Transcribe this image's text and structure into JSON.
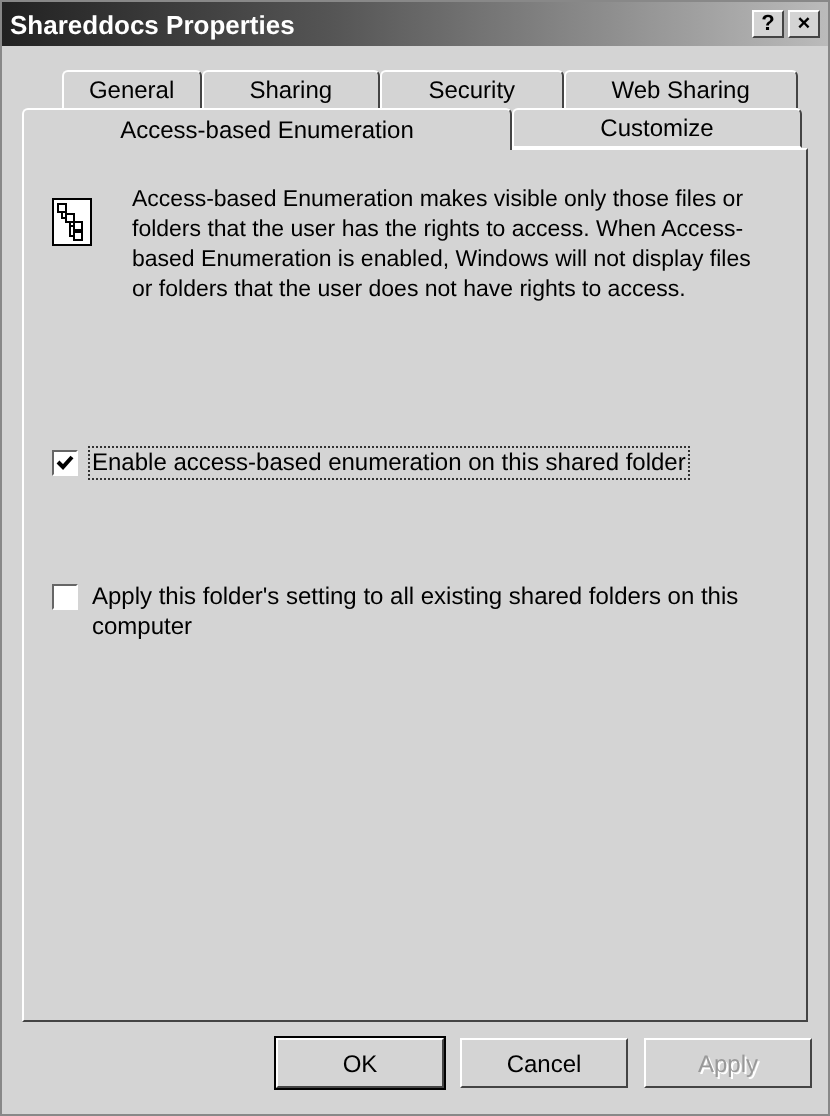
{
  "window": {
    "title": "Shareddocs Properties",
    "buttons": [
      "?",
      "×"
    ]
  },
  "tab_rows": [
    [
      {
        "label": "General",
        "selected": false
      },
      {
        "label": "Sharing",
        "selected": false
      },
      {
        "label": "Security",
        "selected": false
      },
      {
        "label": "Web Sharing",
        "selected": false
      }
    ],
    [
      {
        "label": "Access-based Enumeration",
        "selected": true
      },
      {
        "label": "Customize",
        "selected": false
      }
    ]
  ],
  "description": "Access-based Enumeration makes visible only those files or folders that the user has the rights to access. When Access-based Enumeration is enabled, Windows will not display files or folders that the user does not have rights to access.",
  "options": [
    {
      "label": "Enable access-based enumeration on this shared folder",
      "checked": true,
      "focused": true
    },
    {
      "label": "Apply this folder's setting to all existing shared folders on this computer",
      "checked": false,
      "focused": false
    }
  ],
  "buttons": [
    {
      "label": "OK",
      "default": true,
      "disabled": false
    },
    {
      "label": "Cancel",
      "default": false,
      "disabled": false
    },
    {
      "label": "Apply",
      "default": false,
      "disabled": true
    }
  ]
}
